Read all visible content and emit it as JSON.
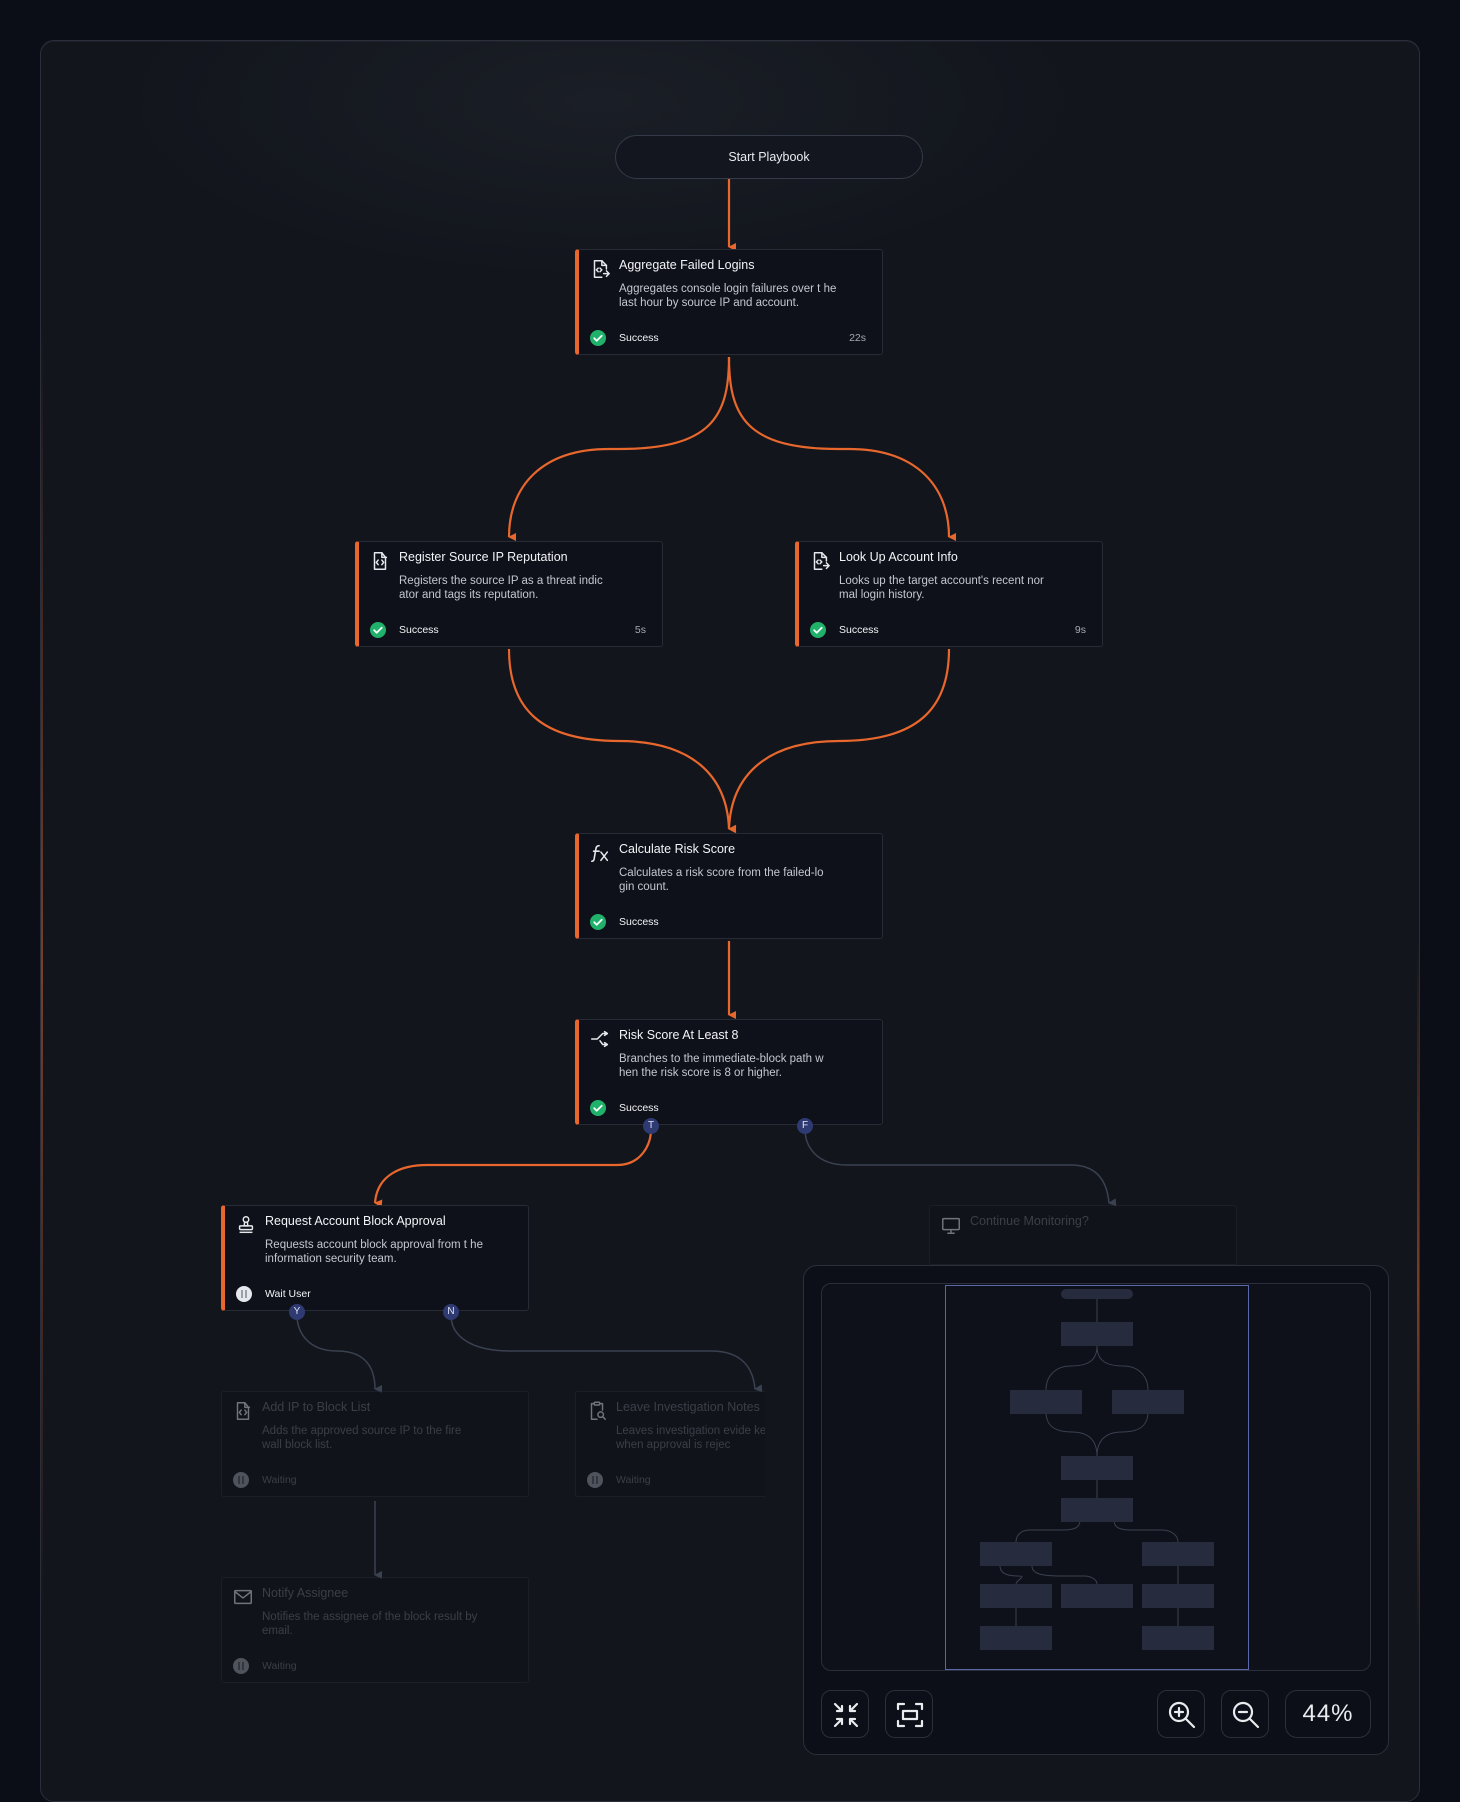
{
  "start": {
    "label": "Start Playbook"
  },
  "nodes": {
    "aggregate": {
      "title": "Aggregate Failed Logins",
      "desc": "Aggregates console login failures over t he last hour by source IP and account.",
      "status": "Success",
      "duration": "22s"
    },
    "register": {
      "title": "Register Source IP Reputation",
      "desc": "Registers the source IP as a threat indic ator and tags its reputation.",
      "status": "Success",
      "duration": "5s"
    },
    "lookup": {
      "title": "Look Up Account Info",
      "desc": "Looks up the target account's recent nor mal login history.",
      "status": "Success",
      "duration": "9s"
    },
    "calc": {
      "title": "Calculate Risk Score",
      "desc": "Calculates a risk score from the failed-lo gin count.",
      "status": "Success",
      "duration": ""
    },
    "risk": {
      "title": "Risk Score At Least 8",
      "desc": "Branches to the immediate-block path w hen the risk score is 8 or higher.",
      "status": "Success",
      "duration": ""
    },
    "request": {
      "title": "Request Account Block Approval",
      "desc": "Requests account block approval from t he information security team.",
      "status": "Wait User",
      "duration": ""
    },
    "continue": {
      "title": "Continue Monitoring?"
    },
    "addip": {
      "title": "Add IP to Block List",
      "desc": "Adds the approved source IP to the fire wall block list.",
      "status": "Waiting",
      "duration": ""
    },
    "notes": {
      "title": "Leave Investigation Notes",
      "desc": "Leaves investigation evide ket when approval is rejec",
      "status": "Waiting",
      "duration": ""
    },
    "notify": {
      "title": "Notify Assignee",
      "desc": "Notifies the assignee of the block result by email.",
      "status": "Waiting",
      "duration": ""
    }
  },
  "ports": {
    "true": "T",
    "false": "F",
    "yes": "Y",
    "no": "N"
  },
  "minimap": {
    "zoom": "44%"
  },
  "colors": {
    "accent": "#e8672c",
    "success": "#20b26b",
    "port": "#2f3a73",
    "muted_edge": "#3a4150"
  }
}
